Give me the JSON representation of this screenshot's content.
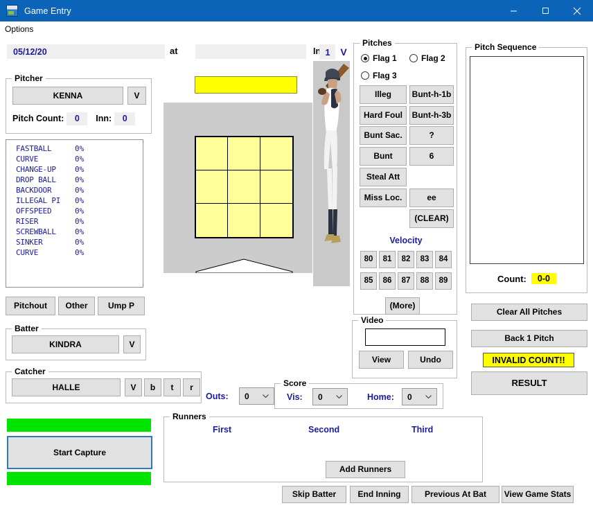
{
  "window": {
    "title": "Game Entry",
    "icon": "app-icon",
    "minimize": "minimize-icon",
    "maximize": "maximize-icon",
    "close": "close-icon"
  },
  "menubar": {
    "items": [
      "Options"
    ]
  },
  "header": {
    "date": "05/12/20",
    "date_placeholder": "",
    "at_label": "at",
    "opponent": "",
    "opponent_placeholder": "",
    "inning_label": "Inn:",
    "inning_value": "1",
    "inning_dropdown": "V"
  },
  "pitcher": {
    "group_label": "Pitcher",
    "name": "KENNA",
    "dropdown": "V",
    "pitch_count_label": "Pitch Count:",
    "pitch_count": "0",
    "inning_label": "Inn:",
    "inning": "0",
    "pitch_types": [
      {
        "name": "FASTBALL",
        "pct": "0%"
      },
      {
        "name": "CURVE",
        "pct": "0%"
      },
      {
        "name": "CHANGE-UP",
        "pct": "0%"
      },
      {
        "name": "DROP BALL",
        "pct": "0%"
      },
      {
        "name": "BACKDOOR",
        "pct": "0%"
      },
      {
        "name": "ILLEGAL PI",
        "pct": "0%"
      },
      {
        "name": "OFFSPEED",
        "pct": "0%"
      },
      {
        "name": "RISER",
        "pct": "0%"
      },
      {
        "name": "SCREWBALL",
        "pct": "0%"
      },
      {
        "name": "SINKER",
        "pct": "0%"
      },
      {
        "name": "CURVE",
        "pct": "0%"
      }
    ],
    "extra_buttons": [
      "Pitchout",
      "Other",
      "Ump P"
    ]
  },
  "batter": {
    "group_label": "Batter",
    "name": "KINDRA",
    "dropdown": "V"
  },
  "catcher": {
    "group_label": "Catcher",
    "name": "HALLE",
    "buttons": [
      "V",
      "b",
      "t",
      "r"
    ]
  },
  "capture": {
    "button_label": "Start Capture",
    "indicator_color": "#00e500"
  },
  "field": {
    "banner_color": "#ffff00",
    "backdrop_color": "#cccccc",
    "zone_color": "#ffff99",
    "zone_cells": 9,
    "batter_photo": "batter-photo"
  },
  "pitches": {
    "group_label": "Pitches",
    "flags": [
      {
        "label": "Flag 1",
        "selected": true
      },
      {
        "label": "Flag 2",
        "selected": false
      },
      {
        "label": "Flag 3",
        "selected": false
      }
    ],
    "left_buttons": [
      "Illeg",
      "Hard Foul",
      "Bunt Sac.",
      "Bunt",
      "Steal Att",
      "Miss Loc."
    ],
    "right_buttons": [
      "Bunt-h-1b",
      "Bunt-h-3b",
      "?",
      "6",
      "ee"
    ],
    "clear_button": "(CLEAR)",
    "velocity_label": "Velocity",
    "velocities": [
      "80",
      "81",
      "82",
      "83",
      "84",
      "85",
      "86",
      "87",
      "88",
      "89"
    ],
    "more_button": "(More)"
  },
  "video": {
    "group_label": "Video",
    "input_value": "",
    "view_button": "View",
    "undo_button": "Undo"
  },
  "outs": {
    "label": "Outs:",
    "value": "0"
  },
  "score": {
    "group_label": "Score",
    "visitor_label": "Vis:",
    "visitor_value": "0",
    "home_label": "Home:",
    "home_value": "0"
  },
  "runners": {
    "group_label": "Runners",
    "columns": [
      "First",
      "Second",
      "Third"
    ],
    "add_button": "Add Runners"
  },
  "pitch_sequence": {
    "group_label": "Pitch Sequence",
    "entries": [],
    "count_label": "Count:",
    "count_value": "0-0",
    "count_highlight": "#ffff00"
  },
  "actions": {
    "clear_all": "Clear All Pitches",
    "back_one": "Back 1 Pitch",
    "invalid_count": "INVALID COUNT!!",
    "invalid_color": "#ffff00",
    "result": "RESULT"
  },
  "bottom_buttons": [
    "Skip Batter",
    "End Inning",
    "Previous At Bat",
    "View Game Stats"
  ]
}
